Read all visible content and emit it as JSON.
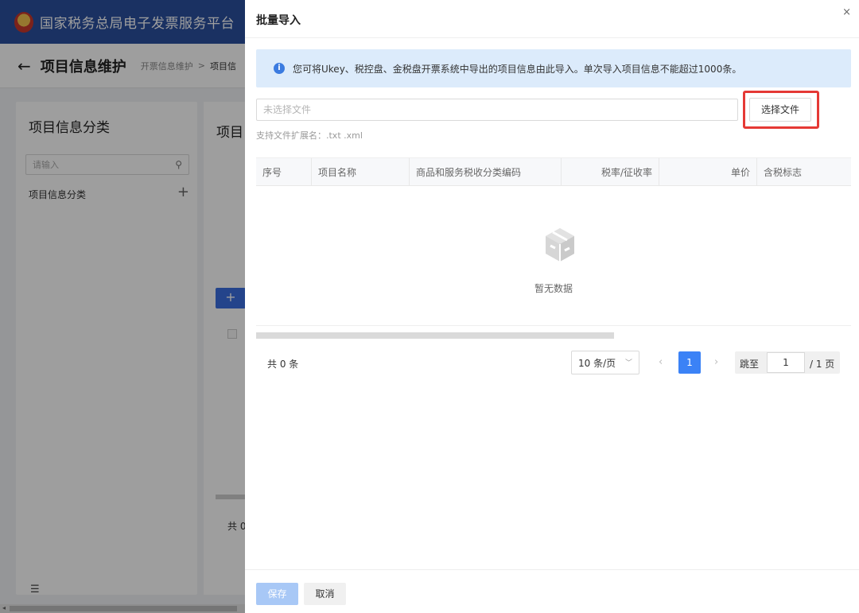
{
  "app": {
    "title": "国家税务总局电子发票服务平台"
  },
  "subheader": {
    "page_title": "项目信息维护",
    "breadcrumb_parent": "开票信息维护",
    "breadcrumb_sep": ">",
    "breadcrumb_current": "项目信"
  },
  "left_panel": {
    "title": "项目信息分类",
    "search_placeholder": "请输入",
    "tree_item": "项目信息分类"
  },
  "right_bg": {
    "title": "项目",
    "add_symbol": "+",
    "total_fragment": "共 0"
  },
  "drawer": {
    "title": "批量导入",
    "close_symbol": "×",
    "alert_text": "您可将Ukey、税控盘、金税盘开票系统中导出的项目信息由此导入。单次导入项目信息不能超过1000条。",
    "file_placeholder": "未选择文件",
    "select_file_label": "选择文件",
    "ext_hint": "支持文件扩展名：.txt .xml",
    "table": {
      "columns": [
        "序号",
        "项目名称",
        "商品和服务税收分类编码",
        "税率/征收率",
        "单价",
        "含税标志"
      ],
      "rows": []
    },
    "empty_text": "暂无数据",
    "pagination": {
      "total_text": "共 0 条",
      "page_size": "10 条/页",
      "current_page": "1",
      "jump_label": "跳至",
      "jump_value": "1",
      "total_pages": "/ 1 页"
    },
    "footer": {
      "save_label": "保存",
      "cancel_label": "取消"
    }
  },
  "colors": {
    "brand_blue": "#2b4f9f",
    "primary": "#3b82f6",
    "alert_bg": "#dcebfb",
    "highlight": "#e53935"
  }
}
